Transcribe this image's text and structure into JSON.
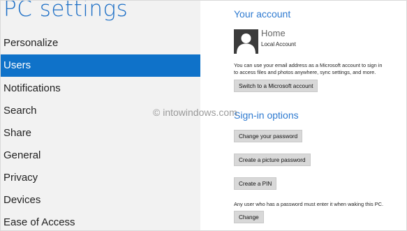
{
  "app": {
    "title": "PC settings"
  },
  "sidebar": {
    "items": [
      {
        "label": "Personalize",
        "selected": false
      },
      {
        "label": "Users",
        "selected": true
      },
      {
        "label": "Notifications",
        "selected": false
      },
      {
        "label": "Search",
        "selected": false
      },
      {
        "label": "Share",
        "selected": false
      },
      {
        "label": "General",
        "selected": false
      },
      {
        "label": "Privacy",
        "selected": false
      },
      {
        "label": "Devices",
        "selected": false
      },
      {
        "label": "Ease of Access",
        "selected": false
      }
    ]
  },
  "your_account": {
    "heading": "Your account",
    "name": "Home",
    "type": "Local Account",
    "description_line1": "You can use your email address as a Microsoft account to sign in",
    "description_line2": "to access files and photos anywhere, sync settings, and more.",
    "switch_button": "Switch to a Microsoft account"
  },
  "sign_in_options": {
    "heading": "Sign-in options",
    "change_password_button": "Change your password",
    "picture_password_button": "Create a picture password",
    "pin_button": "Create a PIN",
    "note": "Any user who has a password must enter it when waking this PC.",
    "change_button": "Change"
  },
  "watermark": {
    "text": "© intowindows.com"
  },
  "colors": {
    "accent": "#0f72c9",
    "heading": "#2e7ad0",
    "sidebar_bg": "#f2f2f2",
    "button_bg": "#d8d8d8"
  }
}
